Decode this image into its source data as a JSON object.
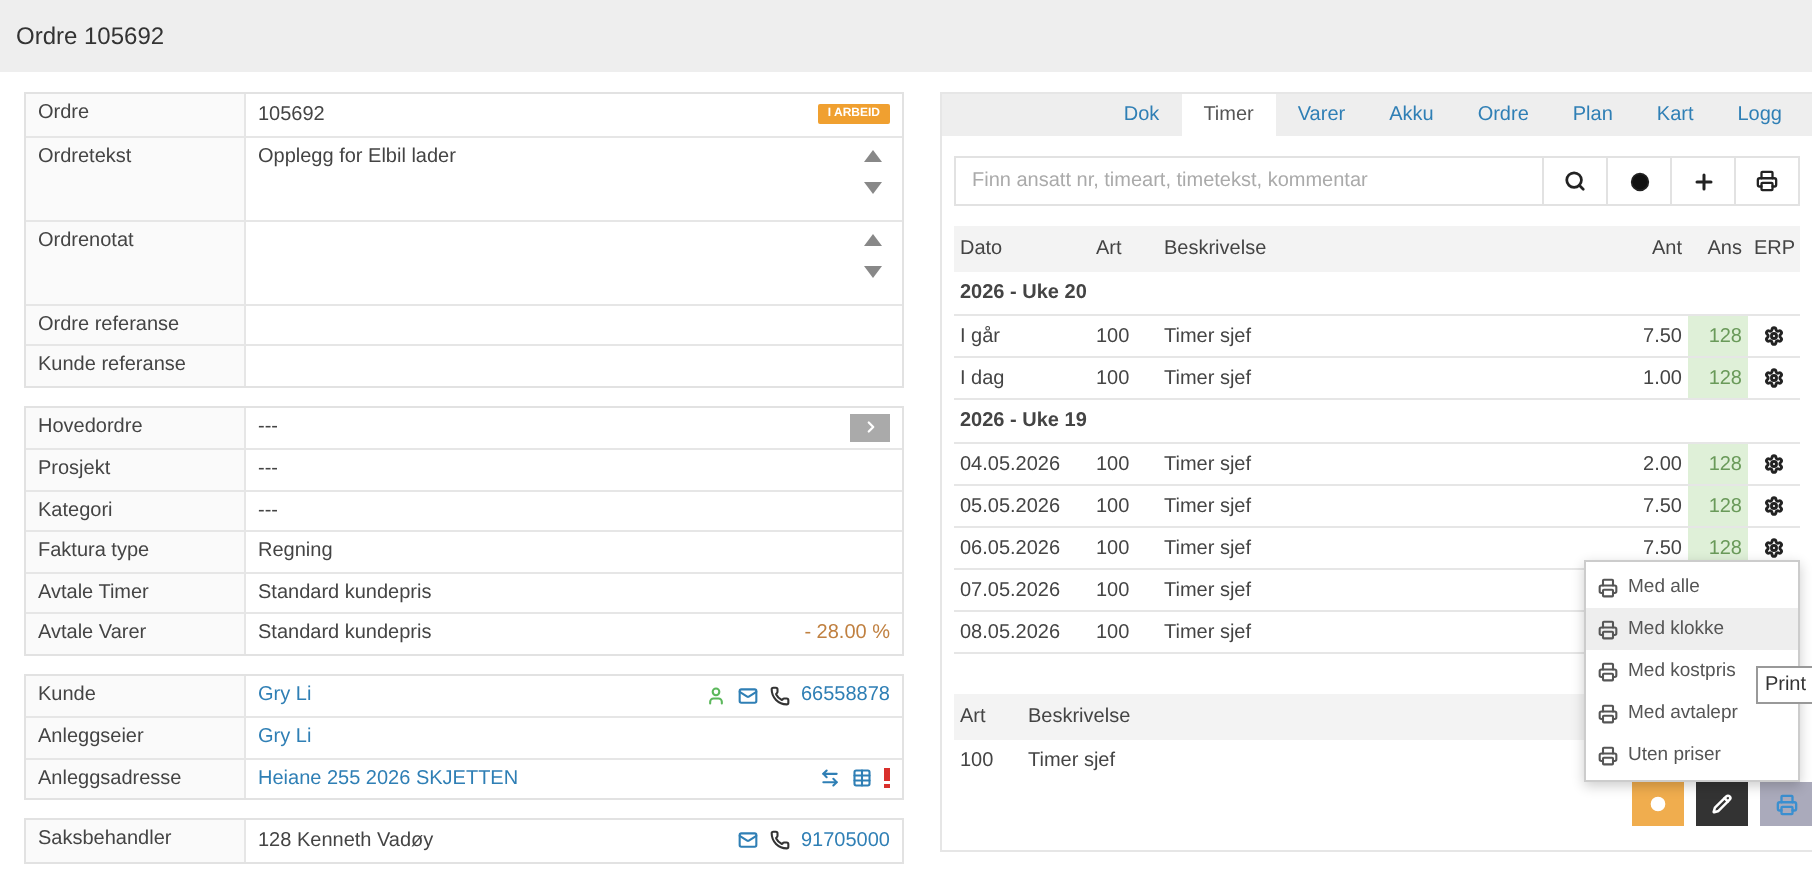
{
  "header": {
    "title": "Ordre 105692"
  },
  "details": {
    "groups": [
      {
        "rows": [
          {
            "label": "Ordre",
            "value": "105692",
            "kind": "text",
            "badge": "I ARBEID"
          },
          {
            "label": "Ordretekst",
            "value": "Opplegg for Elbil lader",
            "kind": "textarea"
          },
          {
            "label": "Ordrenotat",
            "kind": "textarea"
          },
          {
            "label": "Ordre referanse",
            "kind": "text"
          },
          {
            "label": "Kunde referanse",
            "kind": "text"
          }
        ]
      },
      {
        "rows": [
          {
            "label": "Hovedordre",
            "value": "---",
            "kind": "nav"
          },
          {
            "label": "Prosjekt",
            "value": "---",
            "kind": "text"
          },
          {
            "label": "Kategori",
            "value": "---",
            "kind": "text"
          },
          {
            "label": "Faktura type",
            "value": "Regning",
            "kind": "text"
          },
          {
            "label": "Avtale Timer",
            "value": "Standard kundepris",
            "kind": "text"
          },
          {
            "label": "Avtale Varer",
            "value": "Standard kundepris",
            "kind": "text",
            "note": "- 28.00 %"
          }
        ]
      },
      {
        "rows": [
          {
            "label": "Kunde",
            "value": "Gry Li",
            "kind": "customer",
            "link": true,
            "phone": "66558878"
          },
          {
            "label": "Anleggseier",
            "value": "Gry Li",
            "kind": "text",
            "link": true
          },
          {
            "label": "Anleggsadresse",
            "value": "Heiane 255 2026 SKJETTEN",
            "kind": "address",
            "link": true
          }
        ]
      },
      {
        "rows": [
          {
            "label": "Saksbehandler",
            "value": "128 Kenneth Vadøy",
            "kind": "handler",
            "phone": "91705000"
          }
        ]
      }
    ]
  },
  "timer": {
    "tabs": [
      {
        "label": "Dok",
        "selected": false
      },
      {
        "label": "Timer",
        "selected": true
      },
      {
        "label": "Varer",
        "selected": false
      },
      {
        "label": "Akku",
        "selected": false
      },
      {
        "label": "Ordre",
        "selected": false
      },
      {
        "label": "Plan",
        "selected": false
      },
      {
        "label": "Kart",
        "selected": false
      },
      {
        "label": "Logg",
        "selected": false
      }
    ],
    "search": {
      "placeholder": "Finn ansatt nr, timeart, timetekst, kommentar"
    },
    "columns": [
      "Dato",
      "Art",
      "Beskrivelse",
      "Ant",
      "Ans",
      "ERP"
    ],
    "groups": [
      {
        "title": "2026 - Uke 20",
        "rows": [
          {
            "dato": "I går",
            "art": "100",
            "beskrivelse": "Timer sjef",
            "ant": "7.50",
            "ans": "128"
          },
          {
            "dato": "I dag",
            "art": "100",
            "beskrivelse": "Timer sjef",
            "ant": "1.00",
            "ans": "128"
          }
        ]
      },
      {
        "title": "2026 - Uke 19",
        "rows": [
          {
            "dato": "04.05.2026",
            "art": "100",
            "beskrivelse": "Timer sjef",
            "ant": "2.00",
            "ans": "128"
          },
          {
            "dato": "05.05.2026",
            "art": "100",
            "beskrivelse": "Timer sjef",
            "ant": "7.50",
            "ans": "128"
          },
          {
            "dato": "06.05.2026",
            "art": "100",
            "beskrivelse": "Timer sjef",
            "ant": "7.50",
            "ans": "128"
          },
          {
            "dato": "07.05.2026",
            "art": "100",
            "beskrivelse": "Timer sjef"
          },
          {
            "dato": "08.05.2026",
            "art": "100",
            "beskrivelse": "Timer sjef"
          }
        ]
      }
    ],
    "summary": {
      "columns": [
        "Art",
        "Beskrivelse"
      ],
      "rows": [
        {
          "art": "100",
          "beskrivelse": "Timer sjef"
        }
      ]
    },
    "print_menu": {
      "items": [
        {
          "label": "Med alle",
          "selected": false
        },
        {
          "label": "Med klokke",
          "selected": true
        },
        {
          "label": "Med kostpris",
          "selected": false
        },
        {
          "label": "Med avtalepr",
          "selected": false
        },
        {
          "label": "Uten priser",
          "selected": false
        }
      ],
      "tooltip": "Print"
    }
  }
}
